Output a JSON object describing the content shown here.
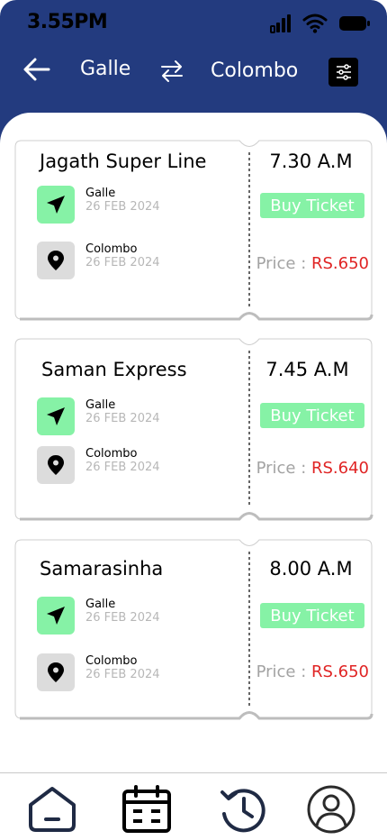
{
  "status_bar": {
    "time": "3.55PM",
    "icons": [
      "cellular-signal-icon",
      "wifi-icon",
      "battery-icon"
    ]
  },
  "header": {
    "back_icon": "arrow-left-icon",
    "from": "Galle",
    "swap_icon": "swap-arrows-icon",
    "to": "Colombo",
    "filter_icon": "sliders-filter-icon"
  },
  "tickets": [
    {
      "name": "Jagath Super Line",
      "time": "7.30 A.M",
      "buy_label": "Buy Ticket",
      "price_label": "Price : ",
      "price_value": "RS.650",
      "origin": {
        "name": "Galle",
        "date": "26 FEB 2024"
      },
      "destination": {
        "name": "Colombo",
        "date": "26 FEB 2024"
      }
    },
    {
      "name": "Saman Express",
      "time": "7.45 A.M",
      "buy_label": "Buy Ticket",
      "price_label": "Price : ",
      "price_value": "RS.640",
      "origin": {
        "name": "Galle",
        "date": "26 FEB 2024"
      },
      "destination": {
        "name": "Colombo",
        "date": "26 FEB 2024"
      }
    },
    {
      "name": "Samarasinha",
      "time": "8.00 A.M",
      "buy_label": "Buy Ticket",
      "price_label": "Price : ",
      "price_value": "RS.650",
      "origin": {
        "name": "Galle",
        "date": "26 FEB 2024"
      },
      "destination": {
        "name": "Colombo",
        "date": "26 FEB 2024"
      }
    }
  ],
  "bottom_nav": {
    "items": [
      "home-icon",
      "calendar-icon",
      "history-icon",
      "profile-icon"
    ]
  },
  "colors": {
    "header_bg": "#233b7f",
    "accent_green": "#86f2a6",
    "price_red": "#e02424",
    "nav_icon": "#1f2a44"
  }
}
